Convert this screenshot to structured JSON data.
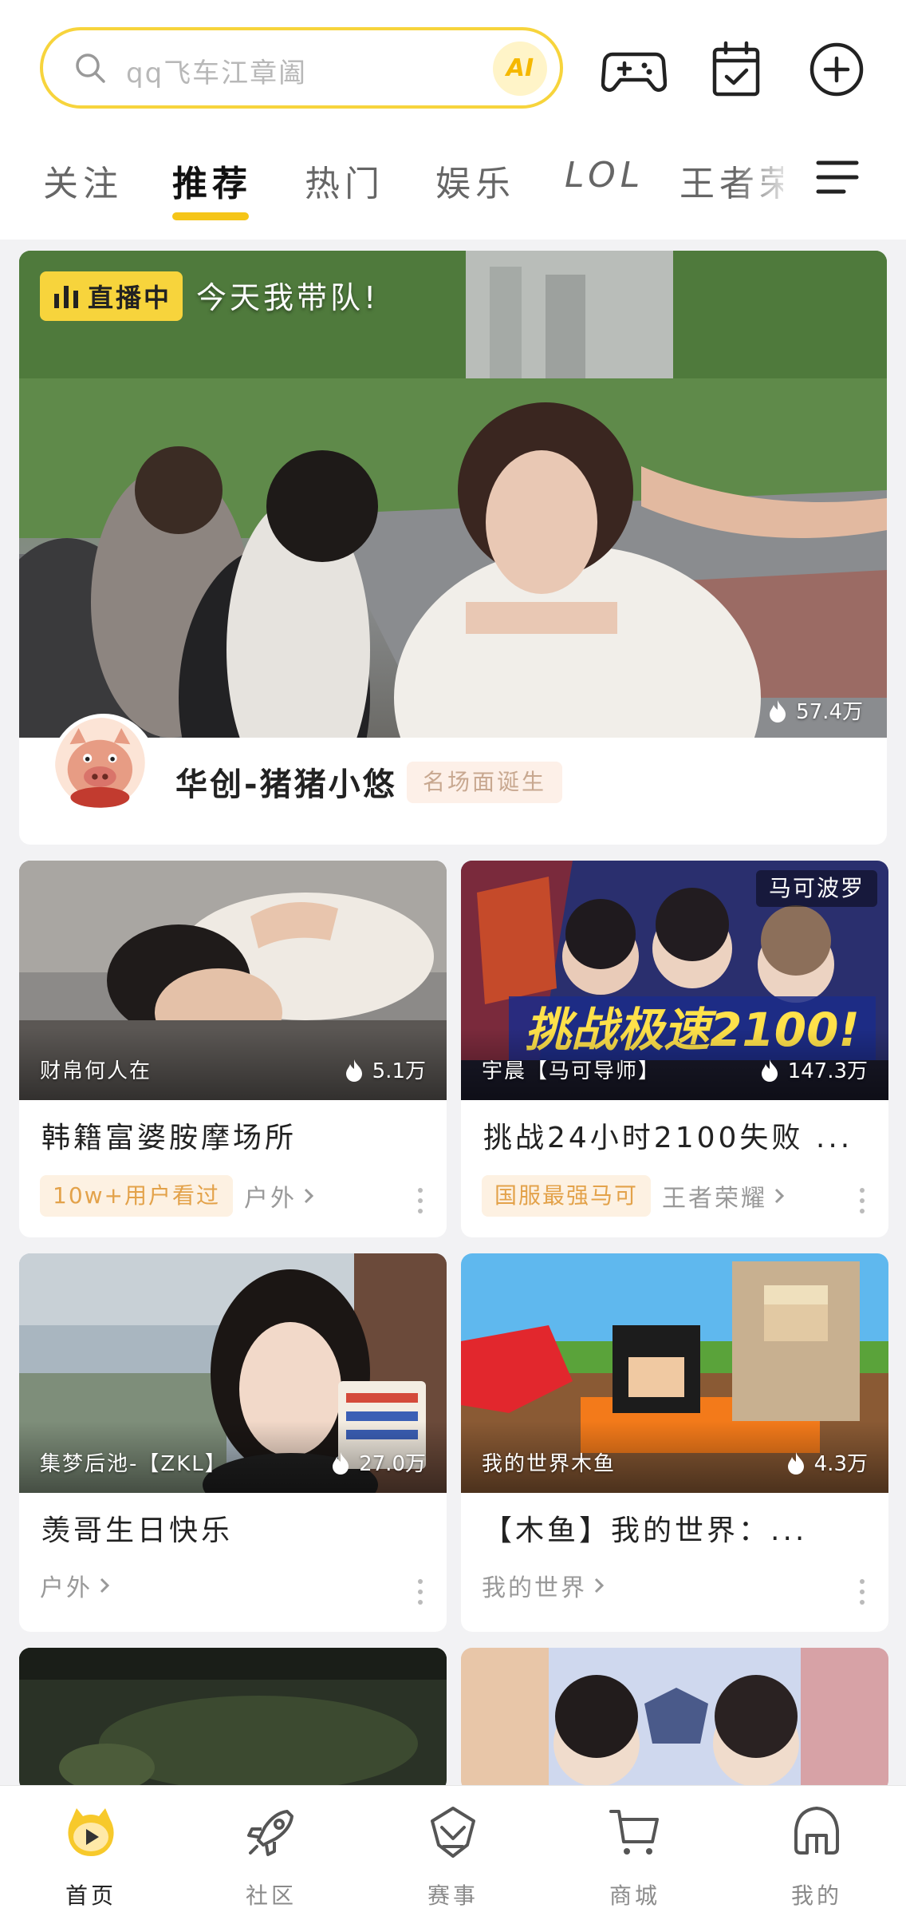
{
  "search": {
    "placeholder": "qq飞车江章阖",
    "ai_label": "AI"
  },
  "header_icons": [
    "gamepad-icon",
    "calendar-check-icon",
    "add-circle-icon"
  ],
  "tabs": [
    {
      "label": "关注",
      "active": false
    },
    {
      "label": "推荐",
      "active": true
    },
    {
      "label": "热门",
      "active": false
    },
    {
      "label": "娱乐",
      "active": false
    },
    {
      "label": "LOL",
      "active": false
    },
    {
      "label": "王者荣",
      "active": false
    }
  ],
  "hero": {
    "live_label": "直播中",
    "title": "今天我带队!",
    "heat": "57.4万",
    "streamer": "华创-猪猪小悠",
    "tag": "名场面诞生"
  },
  "cards": [
    {
      "streamer": "财帛何人在",
      "heat": "5.1万",
      "title": "韩籍富婆胺摩场所",
      "tag": "10w+用户看过",
      "category": "户外",
      "corner": ""
    },
    {
      "streamer": "宇晨【马可导师】",
      "heat": "147.3万",
      "title": "挑战24小时2100失败 ...",
      "tag": "国服最强马可",
      "category": "王者荣耀",
      "corner": "马可波罗"
    },
    {
      "streamer": "集梦后池-【ZKL】",
      "heat": "27.0万",
      "title": "羡哥生日快乐",
      "tag": "",
      "category": "户外",
      "corner": ""
    },
    {
      "streamer": "我的世界木鱼",
      "heat": "4.3万",
      "title": "【木鱼】我的世界：...",
      "tag": "",
      "category": "我的世界",
      "corner": ""
    }
  ],
  "bottom_nav": [
    {
      "label": "首页",
      "active": true
    },
    {
      "label": "社区",
      "active": false
    },
    {
      "label": "赛事",
      "active": false
    },
    {
      "label": "商城",
      "active": false
    },
    {
      "label": "我的",
      "active": false
    }
  ],
  "colors": {
    "accent": "#f7d43c",
    "tag_bg": "#fdf1e2",
    "tag_text": "#e3a24a"
  }
}
